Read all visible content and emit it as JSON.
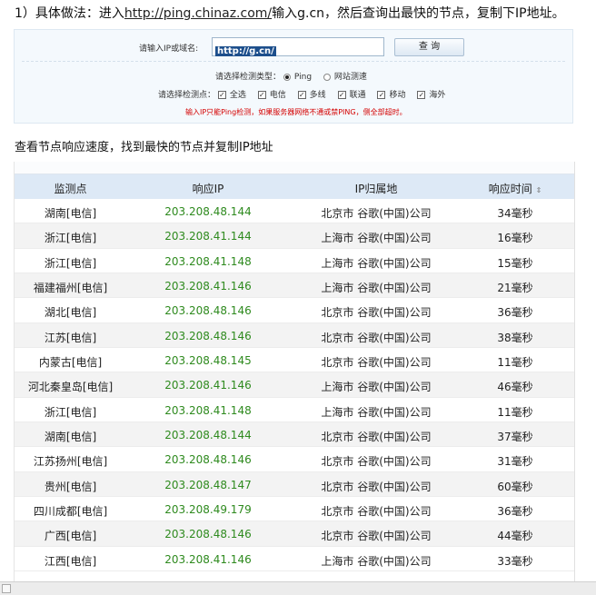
{
  "step1": {
    "prefix": "1）具体做法：进入",
    "link": "http://ping.chinaz.com/",
    "suffix": "输入g.cn，然后查询出最快的节点，复制下IP地址。"
  },
  "panel": {
    "input_label": "请输入IP或域名:",
    "input_value": "http://g.cn/",
    "query_button": "查 询",
    "type_label": "请选择检测类型：",
    "type_options": [
      "Ping",
      "网站测速"
    ],
    "node_label": "请选择检测点：",
    "node_options": [
      "全选",
      "电信",
      "多线",
      "联通",
      "移动",
      "海外"
    ],
    "warning": "输入IP只能Ping检测，如果服务器网络不通或禁PING，侧全部超时。"
  },
  "step2": "查看节点响应速度，找到最快的节点并复制IP地址",
  "table": {
    "headers": [
      "监测点",
      "响应IP",
      "IP归属地",
      "响应时间"
    ],
    "sort_icon": "⇕",
    "rows": [
      [
        "湖南[电信]",
        "203.208.48.144",
        "北京市 谷歌(中国)公司",
        "34毫秒"
      ],
      [
        "浙江[电信]",
        "203.208.41.144",
        "上海市 谷歌(中国)公司",
        "16毫秒"
      ],
      [
        "浙江[电信]",
        "203.208.41.148",
        "上海市 谷歌(中国)公司",
        "15毫秒"
      ],
      [
        "福建福州[电信]",
        "203.208.41.146",
        "上海市 谷歌(中国)公司",
        "21毫秒"
      ],
      [
        "湖北[电信]",
        "203.208.48.146",
        "北京市 谷歌(中国)公司",
        "36毫秒"
      ],
      [
        "江苏[电信]",
        "203.208.48.146",
        "北京市 谷歌(中国)公司",
        "38毫秒"
      ],
      [
        "内蒙古[电信]",
        "203.208.48.145",
        "北京市 谷歌(中国)公司",
        "11毫秒"
      ],
      [
        "河北秦皇岛[电信]",
        "203.208.41.146",
        "上海市 谷歌(中国)公司",
        "46毫秒"
      ],
      [
        "浙江[电信]",
        "203.208.41.148",
        "上海市 谷歌(中国)公司",
        "11毫秒"
      ],
      [
        "湖南[电信]",
        "203.208.48.144",
        "北京市 谷歌(中国)公司",
        "37毫秒"
      ],
      [
        "江苏扬州[电信]",
        "203.208.48.146",
        "北京市 谷歌(中国)公司",
        "31毫秒"
      ],
      [
        "贵州[电信]",
        "203.208.48.147",
        "北京市 谷歌(中国)公司",
        "60毫秒"
      ],
      [
        "四川成都[电信]",
        "203.208.49.179",
        "北京市 谷歌(中国)公司",
        "36毫秒"
      ],
      [
        "广西[电信]",
        "203.208.48.146",
        "北京市 谷歌(中国)公司",
        "44毫秒"
      ],
      [
        "江西[电信]",
        "203.208.41.146",
        "上海市 谷歌(中国)公司",
        "33毫秒"
      ]
    ]
  }
}
